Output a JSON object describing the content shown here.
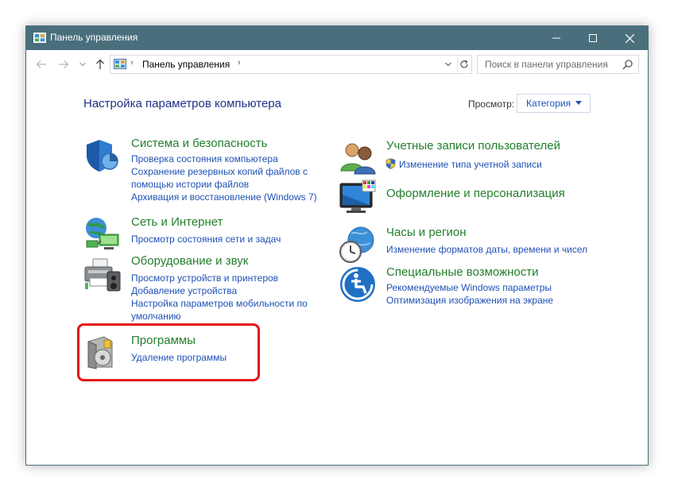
{
  "window": {
    "title": "Панель управления"
  },
  "address": {
    "path": "Панель управления"
  },
  "search": {
    "placeholder": "Поиск в панели управления"
  },
  "heading": "Настройка параметров компьютера",
  "view_by": {
    "label": "Просмотр:",
    "value": "Категория"
  },
  "categories_left": [
    {
      "title": "Система и безопасность",
      "icon": "shield-icon",
      "links": [
        "Проверка состояния компьютера",
        "Сохранение резервных копий файлов с",
        "помощью истории файлов",
        "Архивация и восстановление (Windows 7)"
      ]
    },
    {
      "title": "Сеть и Интернет",
      "icon": "network-icon",
      "links": [
        "Просмотр состояния сети и задач"
      ]
    },
    {
      "title": "Оборудование и звук",
      "icon": "printer-icon",
      "links": [
        "Просмотр устройств и принтеров",
        "Добавление устройства",
        "Настройка параметров мобильности по",
        "умолчанию"
      ]
    },
    {
      "title": "Программы",
      "icon": "programs-disc-icon",
      "links": [
        "Удаление программы"
      ]
    }
  ],
  "categories_right": [
    {
      "title": "Учетные записи пользователей",
      "icon": "users-icon",
      "links": [
        "Изменение типа учетной записи"
      ]
    },
    {
      "title": "Оформление и персонализация",
      "icon": "monitor-palette-icon",
      "links": []
    },
    {
      "title": "Часы и регион",
      "icon": "clock-globe-icon",
      "links": [
        "Изменение форматов даты, времени и чисел"
      ]
    },
    {
      "title": "Специальные возможности",
      "icon": "accessibility-icon",
      "links": [
        "Рекомендуемые Windows параметры",
        "Оптимизация изображения на экране"
      ]
    }
  ],
  "colors": {
    "titlebar": "#4a6f7c",
    "category_title": "#227e2c",
    "link": "#1f51b6",
    "heading": "#1e3287",
    "highlight": "#e3151b"
  }
}
